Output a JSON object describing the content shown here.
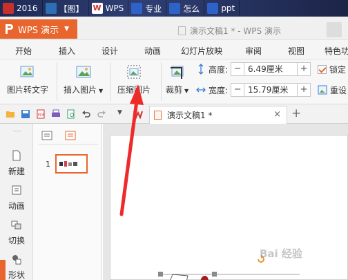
{
  "taskbar": {
    "items": [
      {
        "label": "2016",
        "icon": "app-icon",
        "color": "#c9302c"
      },
      {
        "label": "【图】",
        "icon": "flag-icon",
        "color": "#2c6fb5"
      },
      {
        "label": "WPS",
        "icon": "wps-icon",
        "color": "#d23030"
      },
      {
        "label": "专业",
        "icon": "paw-icon",
        "color": "#2d63c8"
      },
      {
        "label": "怎么",
        "icon": "paw-icon",
        "color": "#2d63c8"
      },
      {
        "label": "ppt",
        "icon": "paw-icon",
        "color": "#2d63c8"
      }
    ]
  },
  "titlebar": {
    "app_label": "WPS 演示",
    "doc_title": "演示文稿1 * - WPS 演示",
    "accent": "#e8662e"
  },
  "menu": {
    "tabs": [
      "开始",
      "插入",
      "设计",
      "动画",
      "幻灯片放映",
      "审阅",
      "视图",
      "特色功"
    ]
  },
  "ribbon": {
    "picture_to_text": "图片转文字",
    "insert_picture": "插入图片",
    "compress_picture": "压缩图片",
    "crop": "裁剪",
    "height_label": "高度:",
    "height_value": "6.49厘米",
    "width_label": "宽度:",
    "width_value": "15.79厘米",
    "lock_label": "锁定",
    "reset_label": "重设"
  },
  "quickbar": {
    "doc_tab_label": "演示文稿1 *",
    "close_glyph": "×",
    "new_tab_glyph": "+"
  },
  "sidebar": {
    "items": [
      {
        "label": "新建",
        "icon": "new-slide-icon"
      },
      {
        "label": "动画",
        "icon": "animation-icon"
      },
      {
        "label": "切换",
        "icon": "transition-icon"
      },
      {
        "label": "形状",
        "icon": "shape-icon"
      }
    ]
  },
  "thumbs": {
    "slide_number": "1"
  },
  "watermark": "Bai 经验"
}
